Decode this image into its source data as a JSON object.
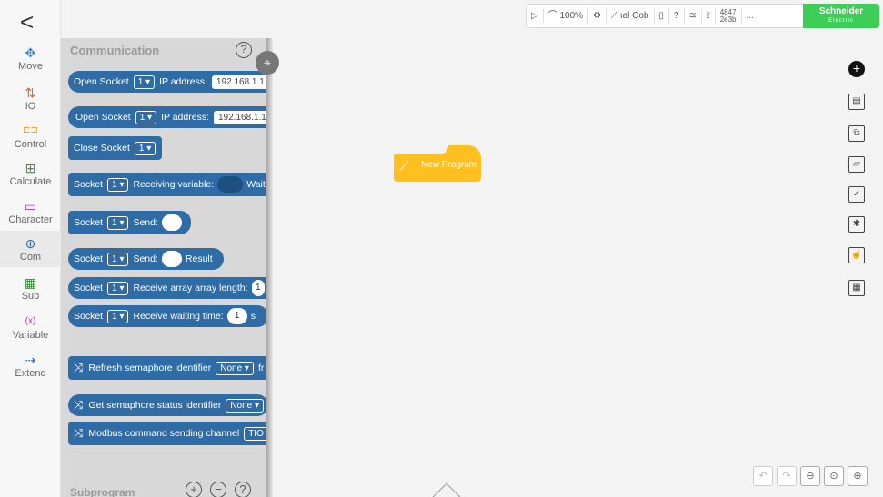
{
  "nav": {
    "back": "<",
    "items": [
      {
        "label": "Move",
        "icon": "move-icon",
        "glyph": "✥"
      },
      {
        "label": "IO",
        "icon": "io-icon",
        "glyph": "⇅"
      },
      {
        "label": "Control",
        "icon": "control-icon",
        "glyph": "⊏⊐"
      },
      {
        "label": "Calculate",
        "icon": "calculate-icon",
        "glyph": "⊞"
      },
      {
        "label": "Character",
        "icon": "character-icon",
        "glyph": "▭"
      },
      {
        "label": "Com",
        "icon": "globe-icon",
        "glyph": "⊕"
      },
      {
        "label": "Sub",
        "icon": "grid-icon",
        "glyph": "▦"
      },
      {
        "label": "Variable",
        "icon": "variable-icon",
        "glyph": "(x)"
      },
      {
        "label": "Extend",
        "icon": "extend-icon",
        "glyph": "⇢"
      }
    ]
  },
  "palette": {
    "title": "Communication",
    "help": "?",
    "blocks": {
      "open1": {
        "label": "Open Socket",
        "num": "1 ▾",
        "ip_label": "IP address:",
        "ip": "192.168.1.1"
      },
      "open2": {
        "label": "Open Socket",
        "num": "1 ▾",
        "ip_label": "IP address:",
        "ip": "192.168.1.1"
      },
      "close": {
        "label": "Close Socket",
        "num": "1 ▾"
      },
      "recv_var": {
        "label": "Socket",
        "num": "1 ▾",
        "text": "Receiving variable:",
        "tail": "Waiti"
      },
      "send1": {
        "label": "Socket",
        "num": "1 ▾",
        "text": "Send:"
      },
      "send2": {
        "label": "Socket",
        "num": "1 ▾",
        "text": "Send:",
        "tail": "Result"
      },
      "recv_arr": {
        "label": "Socket",
        "num": "1 ▾",
        "text": "Receive array  array length:",
        "val": "1"
      },
      "recv_wait": {
        "label": "Socket",
        "num": "1 ▾",
        "text": "Receive  waiting time:",
        "val": "1",
        "unit": "s"
      },
      "refresh": {
        "label": "Refresh semaphore identifier",
        "dd": "None ▾",
        "tail": "fr"
      },
      "getsem": {
        "label": "Get semaphore status identifier",
        "dd": "None ▾"
      },
      "modbus": {
        "label": "Modbus command sending channel",
        "dd": "TIO R"
      }
    },
    "subprogram": "Subprogram"
  },
  "topbar": {
    "play": "▷",
    "speed": "100%",
    "robot": "ıal Cob",
    "help": "?",
    "id_top": "4847",
    "id_bottom": "2e3b",
    "more": "...",
    "brand": "Schneider",
    "brand_sub": "Electric"
  },
  "canvas": {
    "start_label": "New Program"
  },
  "tools": {
    "right": [
      "add-icon",
      "save-icon",
      "save-as-icon",
      "folder-icon",
      "checkbox-icon",
      "shield-icon",
      "hand-icon",
      "calculator-icon"
    ],
    "bottom": [
      "undo-icon",
      "redo-icon",
      "zoom-reset-icon",
      "zoom-in-icon",
      "zoom-out-icon"
    ]
  },
  "colors": {
    "block": "#2f6ca5",
    "start": "#ffbf1f",
    "brand": "#3dcd58"
  }
}
